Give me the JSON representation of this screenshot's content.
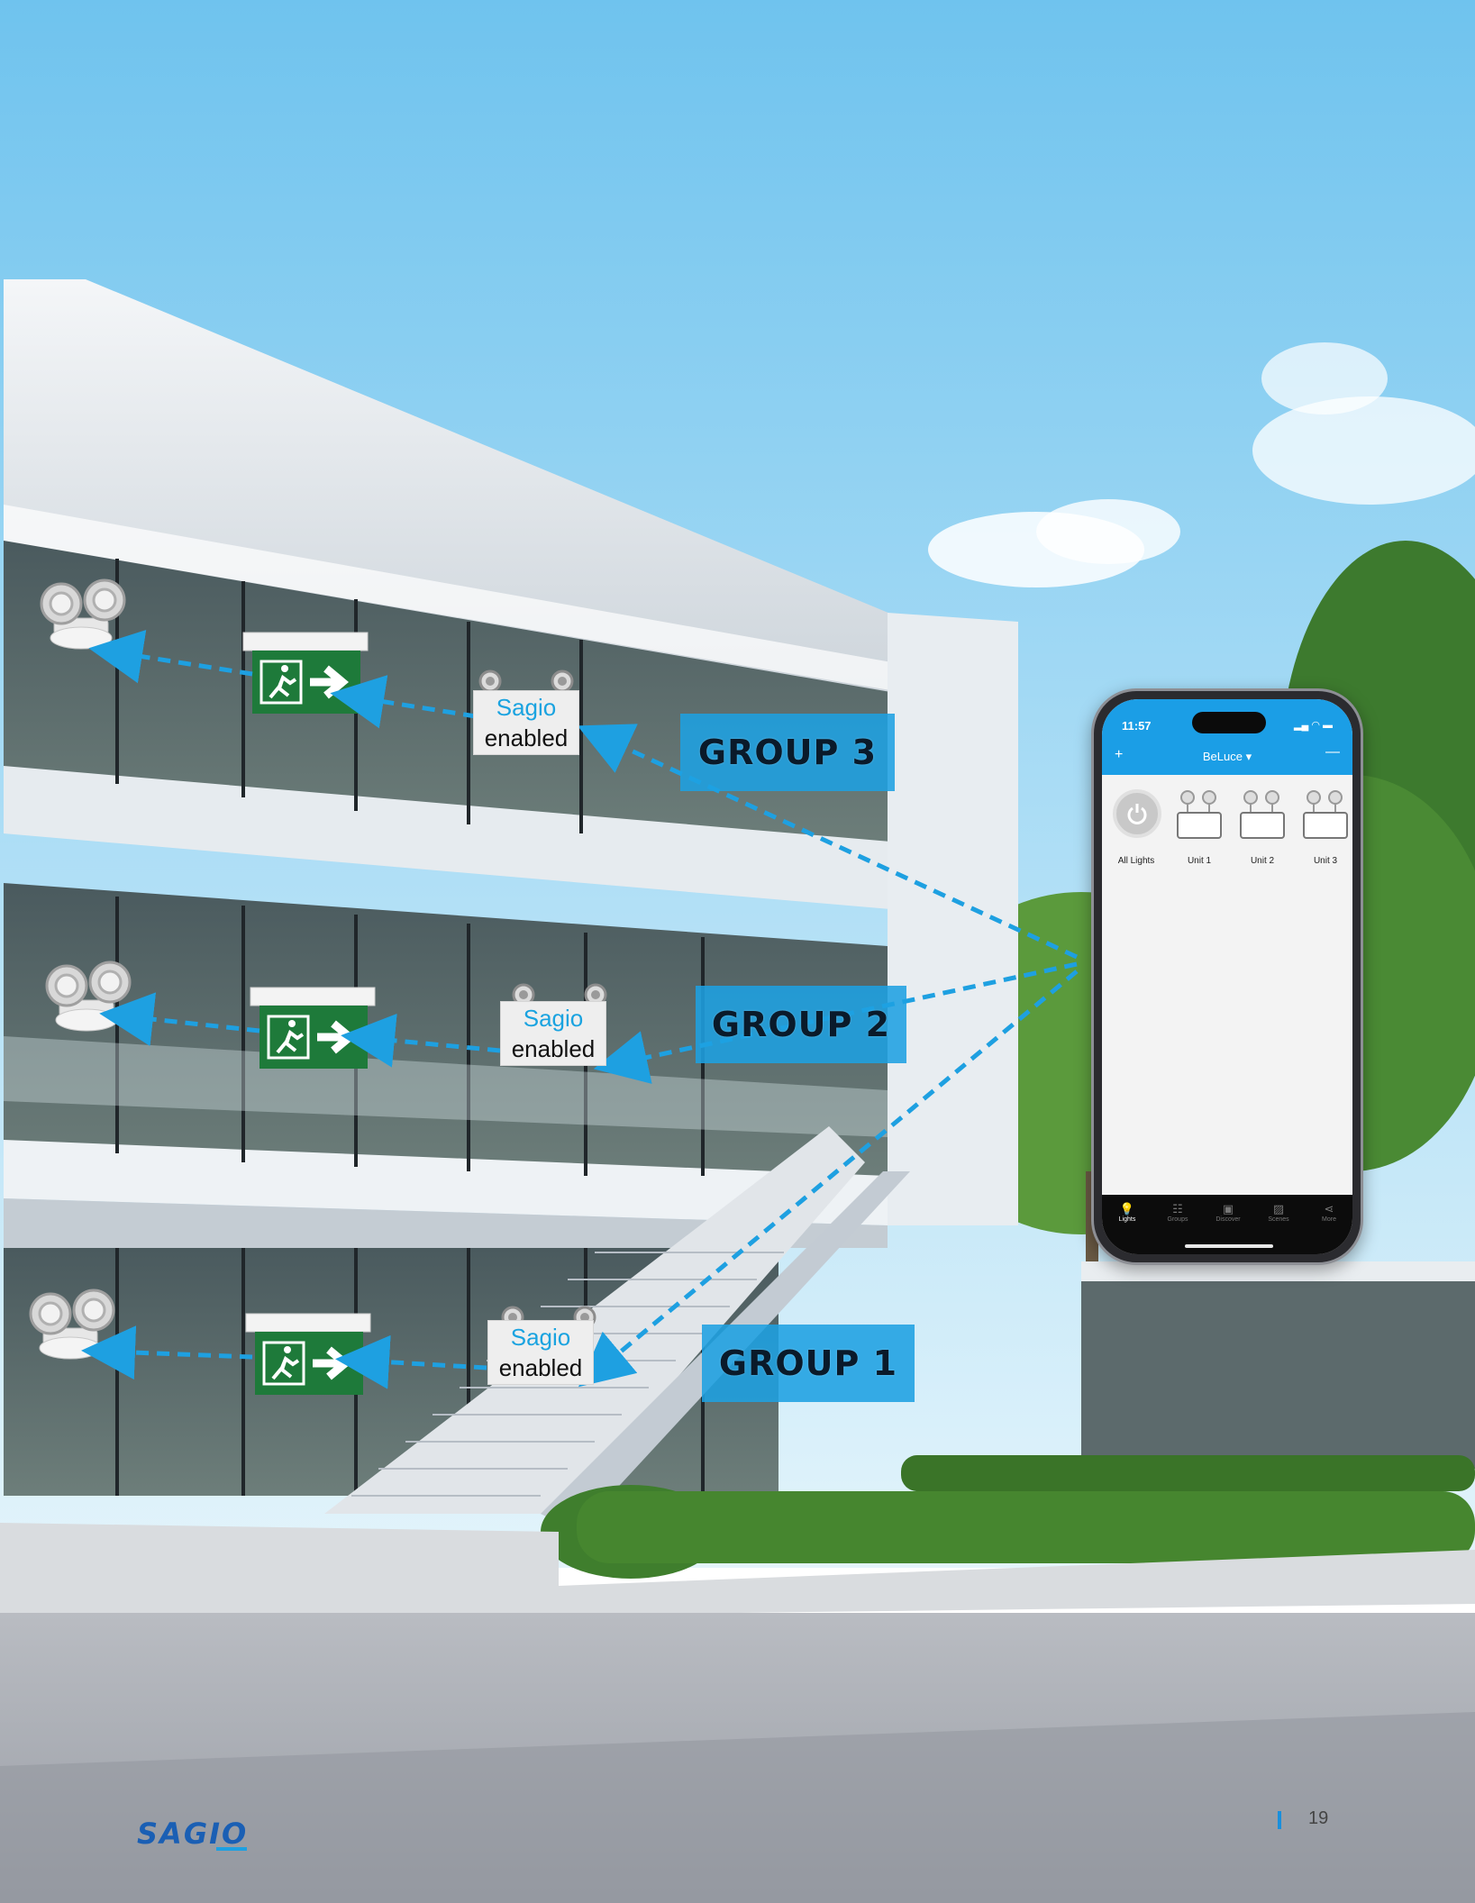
{
  "groups": [
    {
      "label": "GROUP 3"
    },
    {
      "label": "GROUP 2"
    },
    {
      "label": "GROUP 1"
    }
  ],
  "sagio_label": {
    "line1": "Sagio",
    "line2": "enabled"
  },
  "phone": {
    "time": "11:57",
    "app_title": "BeLuce",
    "tiles": [
      "All Lights",
      "Unit 1",
      "Unit 2",
      "Unit 3"
    ],
    "tabs": [
      "Lights",
      "Groups",
      "Discover",
      "Scenes",
      "More"
    ]
  },
  "footer": {
    "logo": "SAGIO",
    "page_number": "19"
  },
  "colors": {
    "accent": "#1ea0e1",
    "exit_sign_green": "#1e7a3a",
    "sky_top": "#8fd0f2",
    "sky_bottom": "#d8f0fb"
  },
  "icons": [
    "remote-head-icon",
    "exit-sign-icon",
    "running-man-icon",
    "arrow-right-icon",
    "power-icon",
    "bulb-icon"
  ]
}
